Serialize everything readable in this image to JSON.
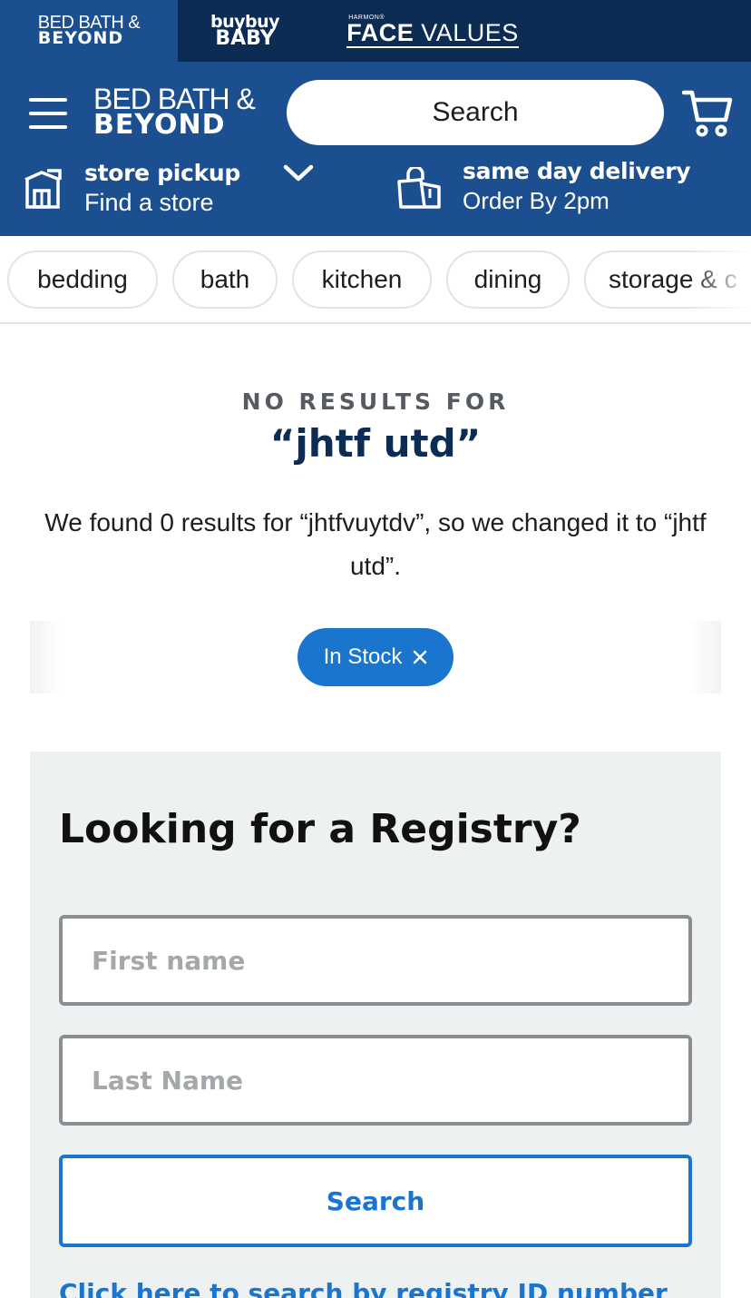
{
  "brand_strip": {
    "bbb_line1": "BED BATH &",
    "bbb_line2": "BEYOND",
    "baby_line1": "buybuy",
    "baby_line2": "BABY",
    "harmon": "HARMON®",
    "face_bold": "FACE",
    "face_light": " VALUES"
  },
  "header": {
    "logo_line1": "BED BATH &",
    "logo_line2": "BEYOND",
    "search_placeholder": "Search",
    "pickup_title": "store pickup",
    "pickup_sub": "Find a store",
    "delivery_title": "same day delivery",
    "delivery_sub": "Order By 2pm"
  },
  "categories": [
    "bedding",
    "bath",
    "kitchen",
    "dining",
    "storage & c"
  ],
  "no_results": {
    "label": "NO RESULTS FOR",
    "query": "“jhtf utd”",
    "description": "We found 0 results for “jhtfvuytdv”, so we changed it to “jhtf utd”."
  },
  "filters": {
    "active": "In Stock"
  },
  "registry": {
    "title": "Looking for a Registry?",
    "first_name_placeholder": "First name",
    "last_name_placeholder": "Last Name",
    "search_label": "Search",
    "id_link": "Click here to search by registry ID number"
  },
  "colors": {
    "navy": "#0d2c54",
    "header_blue": "#1c4f8f",
    "accent_blue": "#1a75cf"
  },
  "icons": [
    "menu-icon",
    "cart-icon",
    "store-icon",
    "chevron-down-icon",
    "shopping-bag-icon",
    "close-icon"
  ]
}
